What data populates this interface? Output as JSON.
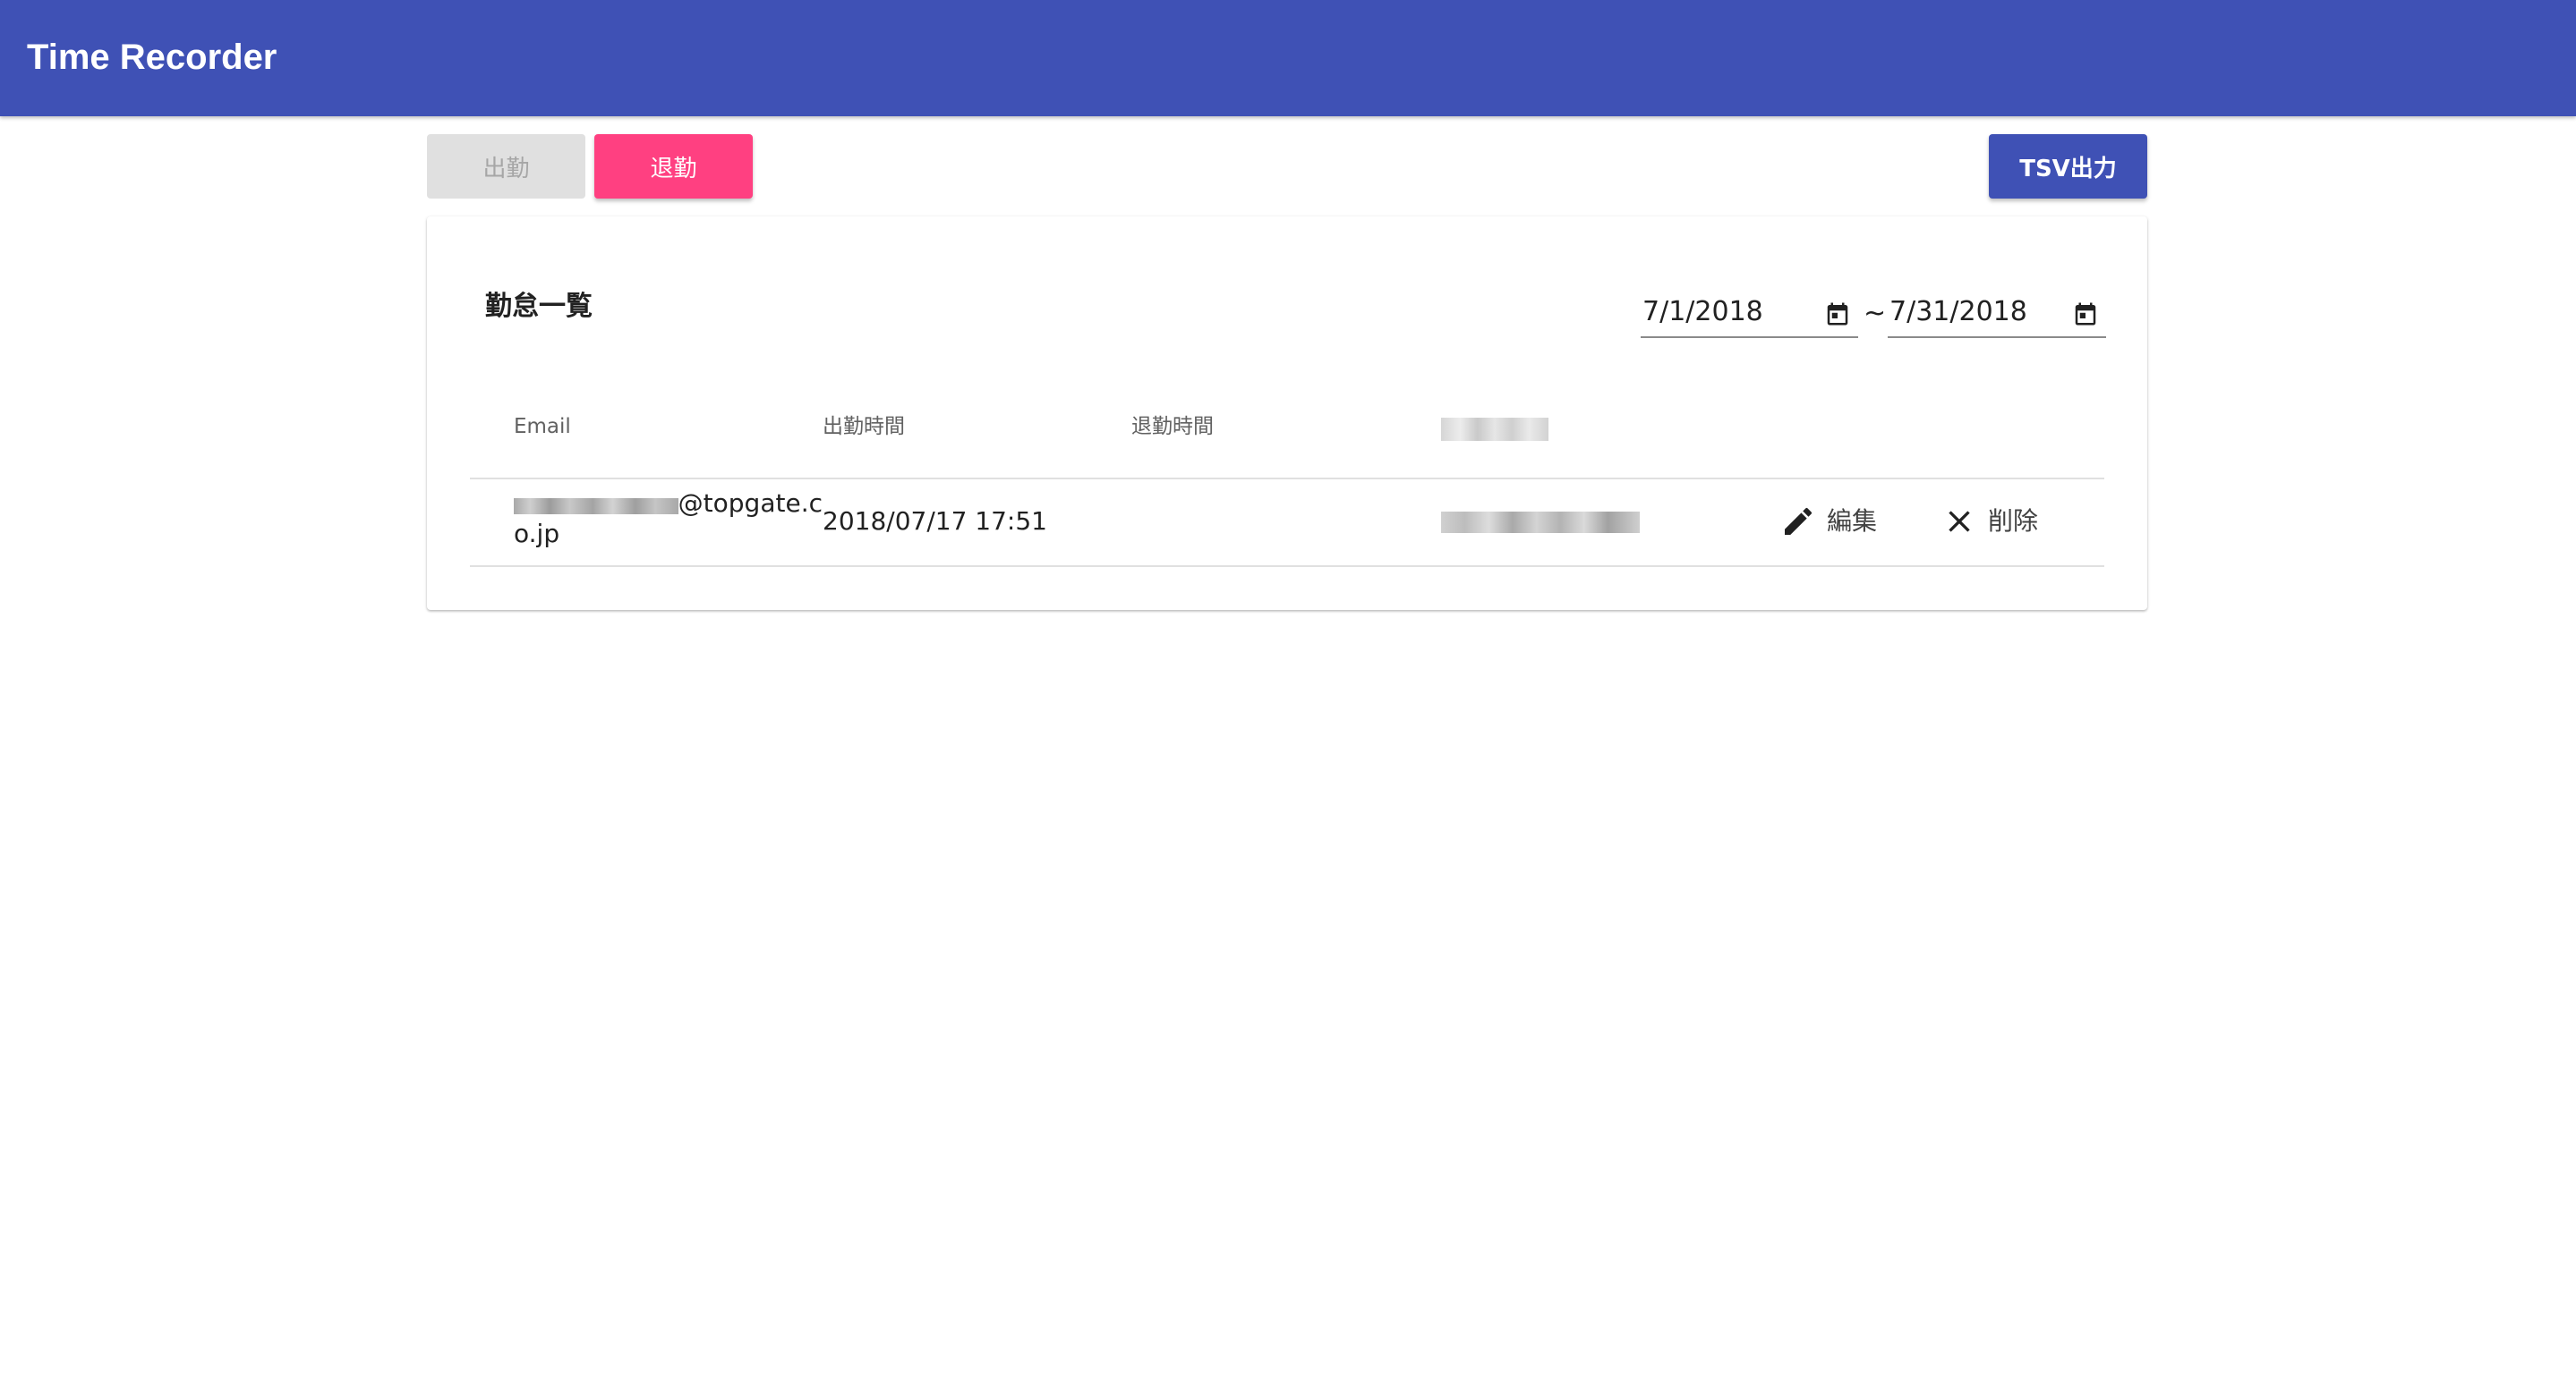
{
  "app": {
    "title": "Time Recorder"
  },
  "toolbar": {
    "clock_in_label": "出勤",
    "clock_out_label": "退勤",
    "tsv_label": "TSV出力"
  },
  "attendance": {
    "title": "勤怠一覧",
    "date_from": "7/1/2018",
    "date_separator": "~",
    "date_to": "7/31/2018",
    "columns": [
      "Email",
      "出勤時間",
      "退勤時間"
    ],
    "rows": [
      {
        "email_domain": "@topgate.c",
        "email_tail": "o.jp",
        "clock_in": "2018/07/17 17:51",
        "clock_out": "",
        "edit_label": "編集",
        "delete_label": "削除"
      }
    ]
  },
  "icons": {
    "calendar": "calendar-icon",
    "edit": "pencil-icon",
    "delete": "close-icon"
  },
  "colors": {
    "primary": "#3f51b5",
    "accent": "#ff4081",
    "disabled_bg": "#e0e0e0",
    "disabled_text": "#a6a6a6"
  }
}
